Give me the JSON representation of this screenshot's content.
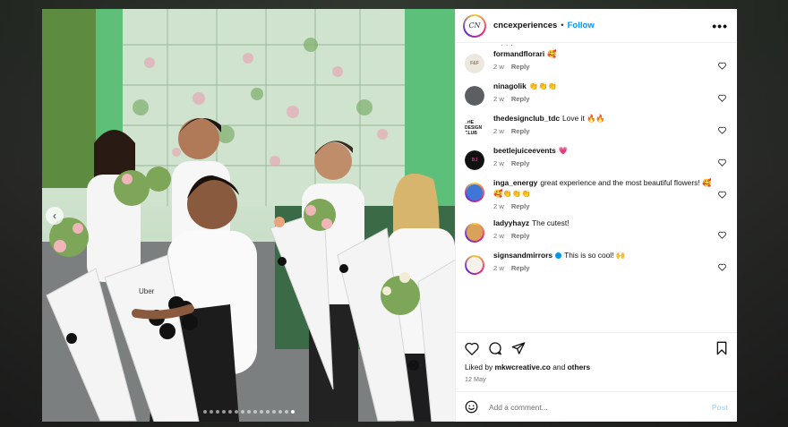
{
  "header": {
    "username": "cncexperiences",
    "avatar_text": "CN",
    "separator": "•",
    "follow_label": "Follow",
    "more_label": "•••"
  },
  "photo": {
    "prev_label": "‹",
    "carousel_count": 15,
    "active_index": 14,
    "bouquet_brand": "Uber"
  },
  "comments": [
    {
      "user": "formandflorari",
      "text": "🥰",
      "time": "2 w",
      "reply": "Reply",
      "avatar_bg": "#ece7df",
      "avatar_fg": "#8a7c66",
      "avatar_text": "F&F",
      "ring": false
    },
    {
      "user": "ninagolik",
      "text": "👏👏👏",
      "time": "2 w",
      "reply": "Reply",
      "avatar_bg": "#5b5f62",
      "avatar_fg": "#ffffff",
      "avatar_text": "",
      "ring": false
    },
    {
      "user": "thedesignclub_tdc",
      "text": "Love it 🔥🔥",
      "time": "2 w",
      "reply": "Reply",
      "avatar_bg": "#ffffff",
      "avatar_fg": "#111111",
      "avatar_text": "THE DESIGN CLUB",
      "ring": false
    },
    {
      "user": "beetlejuiceevents",
      "text": "💗",
      "time": "2 w",
      "reply": "Reply",
      "avatar_bg": "#111111",
      "avatar_fg": "#e6287d",
      "avatar_text": "BJ",
      "ring": false
    },
    {
      "user": "inga_energy",
      "text": "great experience and the most beautiful flowers! 🥰🥰👏👏👏",
      "time": "2 w",
      "reply": "Reply",
      "avatar_bg": "#3f77d6",
      "avatar_fg": "#ffffff",
      "avatar_text": "",
      "ring": true
    },
    {
      "user": "ladyyhayz",
      "text": "The cutest!",
      "time": "2 w",
      "reply": "Reply",
      "avatar_bg": "#d9a25a",
      "avatar_fg": "#ffffff",
      "avatar_text": "",
      "ring": true
    },
    {
      "user": "signsandmirrors",
      "text": "This is so cool! 🙌",
      "time": "2 w",
      "reply": "Reply",
      "avatar_bg": "#f4f1ea",
      "avatar_fg": "#444444",
      "avatar_text": "",
      "ring": true,
      "verified": true
    }
  ],
  "likes": {
    "prefix": "Liked by",
    "user": "mkwcreative.co",
    "connector": "and",
    "others": "others"
  },
  "date": "12 May",
  "add_comment": {
    "placeholder": "Add a comment...",
    "post_label": "Post"
  },
  "colors": {
    "accent": "#0095f6",
    "post_disabled": "#b3dbff",
    "muted": "#737373"
  }
}
